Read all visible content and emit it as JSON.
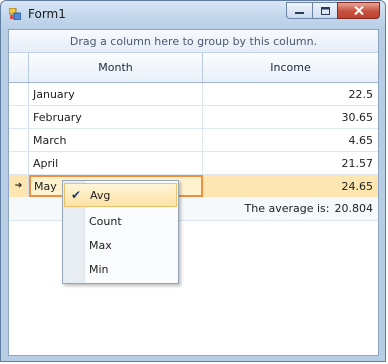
{
  "window": {
    "title": "Form1"
  },
  "grid": {
    "group_panel_text": "Drag a column here to group by this column.",
    "columns": [
      "Month",
      "Income"
    ],
    "rows": [
      {
        "month": "January",
        "income": "22.5"
      },
      {
        "month": "February",
        "income": "30.65"
      },
      {
        "month": "March",
        "income": "4.65"
      },
      {
        "month": "April",
        "income": "21.57"
      },
      {
        "month": "May",
        "income": "24.65"
      }
    ],
    "current_row_indicator": "➔",
    "summary": {
      "label": "The average is:",
      "value": "20.804"
    }
  },
  "summary_menu": {
    "items": [
      {
        "label": "Avg",
        "checked": true
      },
      {
        "label": "Count",
        "checked": false
      },
      {
        "label": "Max",
        "checked": false
      },
      {
        "label": "Min",
        "checked": false
      }
    ],
    "check_icon": "✔"
  },
  "colors": {
    "selection": "#fde6b2",
    "focus_border": "#f08f3d",
    "close_button": "#c8513f"
  }
}
